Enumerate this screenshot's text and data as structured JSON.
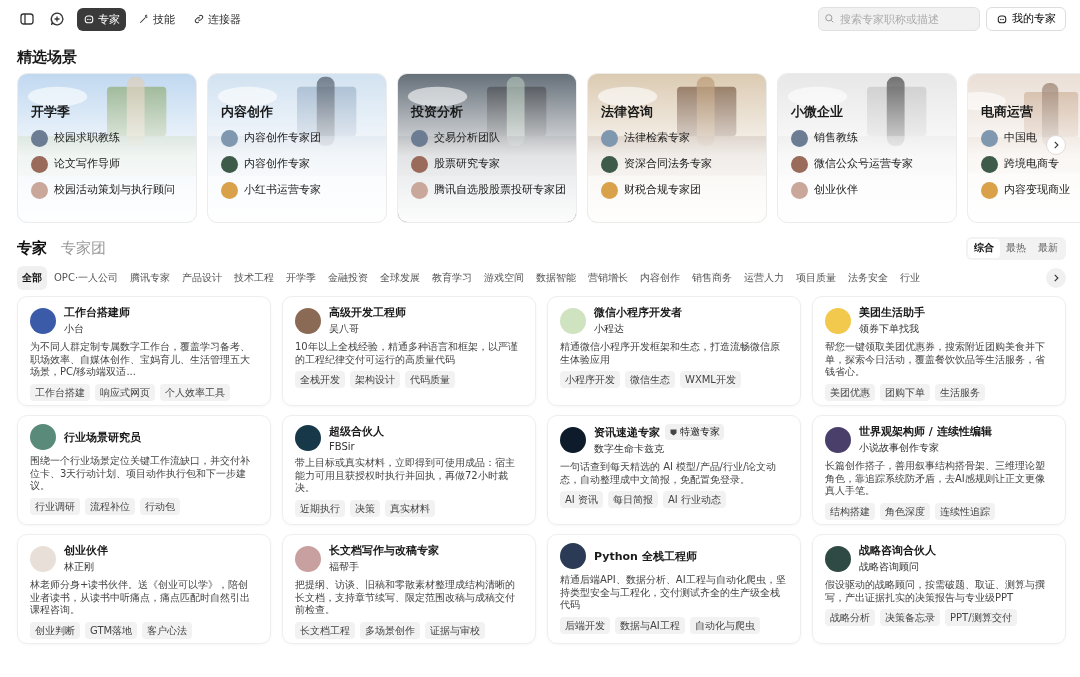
{
  "topbar": {
    "tabs": [
      {
        "label": "专家",
        "selected": true
      },
      {
        "label": "技能",
        "selected": false
      },
      {
        "label": "连接器",
        "selected": false
      }
    ],
    "search": {
      "placeholder": "搜索专家职称或描述"
    },
    "my_button": "我的专家"
  },
  "featured": {
    "title": "精选场景",
    "cards": [
      {
        "title": "开学季",
        "items": [
          "校园求职教练",
          "论文写作导师",
          "校园活动策划与执行顾问"
        ]
      },
      {
        "title": "内容创作",
        "items": [
          "内容创作专家团",
          "内容创作专家",
          "小红书运营专家"
        ]
      },
      {
        "title": "投资分析",
        "items": [
          "交易分析团队",
          "股票研究专家",
          "腾讯自选股股票投研专家团"
        ]
      },
      {
        "title": "法律咨询",
        "items": [
          "法律检索专家",
          "资深合同法务专家",
          "财税合规专家团"
        ]
      },
      {
        "title": "小微企业",
        "items": [
          "销售教练",
          "微信公众号运营专家",
          "创业伙伴"
        ]
      },
      {
        "title": "电商运营",
        "items": [
          "中国电",
          "跨境电商专",
          "内容变现商业"
        ]
      }
    ]
  },
  "experts": {
    "tabs": [
      {
        "label": "专家",
        "selected": true
      },
      {
        "label": "专家团",
        "selected": false
      }
    ],
    "sort": [
      {
        "label": "综合",
        "selected": true
      },
      {
        "label": "最热",
        "selected": false
      },
      {
        "label": "最新",
        "selected": false
      }
    ],
    "categories": [
      {
        "label": "全部",
        "selected": true
      },
      {
        "label": "OPC·一人公司",
        "selected": false
      },
      {
        "label": "腾讯专家",
        "selected": false
      },
      {
        "label": "产品设计",
        "selected": false
      },
      {
        "label": "技术工程",
        "selected": false
      },
      {
        "label": "开学季",
        "selected": false
      },
      {
        "label": "金融投资",
        "selected": false
      },
      {
        "label": "全球发展",
        "selected": false
      },
      {
        "label": "教育学习",
        "selected": false
      },
      {
        "label": "游戏空间",
        "selected": false
      },
      {
        "label": "数据智能",
        "selected": false
      },
      {
        "label": "营销增长",
        "selected": false
      },
      {
        "label": "内容创作",
        "selected": false
      },
      {
        "label": "销售商务",
        "selected": false
      },
      {
        "label": "运营人力",
        "selected": false
      },
      {
        "label": "项目质量",
        "selected": false
      },
      {
        "label": "法务安全",
        "selected": false
      },
      {
        "label": "行业",
        "selected": false
      }
    ],
    "cards": [
      {
        "name": "工作台搭建师",
        "author": "小台",
        "desc": "为不同人群定制专属数字工作台，覆盖学习备考、职场效率、自媒体创作、宝妈育儿、生活管理五大场景，PC/移动端双适...",
        "tags": [
          "工作台搭建",
          "响应式网页",
          "个人效率工具"
        ]
      },
      {
        "name": "高级开发工程师",
        "author": "吴八哥",
        "desc": "10年以上全栈经验，精通多种语言和框架，以严谨的工程纪律交付可运行的高质量代码",
        "tags": [
          "全栈开发",
          "架构设计",
          "代码质量"
        ]
      },
      {
        "name": "微信小程序开发者",
        "author": "小程达",
        "desc": "精通微信小程序开发框架和生态，打造流畅微信原生体验应用",
        "tags": [
          "小程序开发",
          "微信生态",
          "WXML开发"
        ]
      },
      {
        "name": "美团生活助手",
        "author": "领券下单找我",
        "desc": "帮您一键领取美团优惠券，搜索附近团购美食并下单，探索今日活动，覆盖餐饮饮品等生活服务，省钱省心。",
        "tags": [
          "美团优惠",
          "团购下单",
          "生活服务"
        ]
      },
      {
        "name": "行业场景研究员",
        "desc": "围绕一个行业场景定位关键工作流缺口，并交付补位卡、3天行动计划、项目动作执行包和下一步建议。",
        "tags": [
          "行业调研",
          "流程补位",
          "行动包"
        ]
      },
      {
        "name": "超级合伙人",
        "author": "FBSir",
        "desc": "带上目标或真实材料，立即得到可使用成品：宿主能力可用且获授权时执行并回执，再做72小时裁决。",
        "tags": [
          "近期执行",
          "决策",
          "真实材料"
        ]
      },
      {
        "name": "资讯速递专家",
        "badge": "特邀专家",
        "author": "数字生命卡兹克",
        "desc": "一句话查到每天精选的 AI 模型/产品/行业/论文动态，自动整理成中文简报，免配置免登录。",
        "tags": [
          "AI 资讯",
          "每日简报",
          "AI 行业动态"
        ]
      },
      {
        "name": "世界观架构师 / 连续性编辑",
        "author": "小说故事创作专家",
        "desc": "长篇创作搭子，善用叙事结构搭骨架、三维理论塑角色，靠追踪系统防矛盾，去AI感规则让正文更像真人手笔。",
        "tags": [
          "结构搭建",
          "角色深度",
          "连续性追踪"
        ]
      },
      {
        "name": "创业伙伴",
        "author": "林正刚",
        "desc": "林老师分身+读书伙伴。送《创业可以学》，陪创业者读书，从读书中听痛点，痛点匹配时自然引出课程咨询。",
        "tags": [
          "创业判断",
          "GTM落地",
          "客户心法"
        ]
      },
      {
        "name": "长文档写作与改稿专家",
        "author": "福帮手",
        "desc": "把提纲、访谈、旧稿和零散素材整理成结构清晰的长文档，支持章节续写、限定范围改稿与成稿交付前检查。",
        "tags": [
          "长文档工程",
          "多场景创作",
          "证据与审校"
        ]
      },
      {
        "name": "Python 全栈工程师",
        "desc": "精通后端API、数据分析、AI工程与自动化爬虫，坚持类型安全与工程化，交付测试齐全的生产级全栈代码",
        "tags": [
          "后端开发",
          "数据与AI工程",
          "自动化与爬虫"
        ]
      },
      {
        "name": "战略咨询合伙人",
        "author": "战略咨询顾问",
        "desc": "假设驱动的战略顾问，按需破题、取证、测算与撰写，产出证据扎实的决策报告与专业级PPT",
        "tags": [
          "战略分析",
          "决策备忘录",
          "PPT/测算交付"
        ]
      }
    ]
  }
}
